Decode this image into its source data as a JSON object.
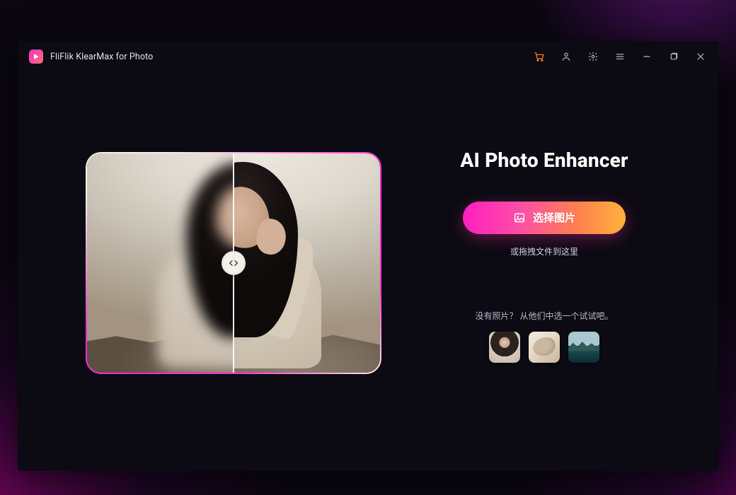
{
  "app": {
    "title": "FliFlik KlearMax for Photo"
  },
  "titlebar_icons": {
    "cart": "cart-icon",
    "account": "user-icon",
    "settings": "gear-icon",
    "menu": "menu-icon",
    "minimize": "minimize-icon",
    "maximize": "maximize-restore-icon",
    "close": "close-icon"
  },
  "main": {
    "headline": "AI Photo Enhancer",
    "cta_label": "选择图片",
    "drag_hint": "或拖拽文件到这里",
    "samples_label": "没有照片？ 从他们中选一个试试吧。",
    "sample_alts": [
      "sample-portrait",
      "sample-hands",
      "sample-landscape"
    ]
  },
  "colors": {
    "gradient_start": "#ff1fbf",
    "gradient_end": "#ffb23a",
    "cart_accent": "#ff8a1e"
  }
}
